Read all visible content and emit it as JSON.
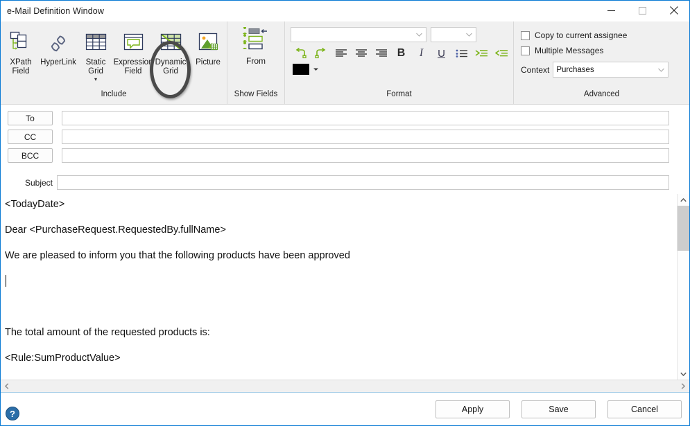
{
  "window": {
    "title": "e-Mail Definition Window",
    "controls": {
      "minimize": "minimize-button",
      "maximize": "maximize-button",
      "close": "close-button"
    }
  },
  "ribbon": {
    "groups": [
      {
        "label": "Include",
        "items": [
          {
            "caption": "XPath\nField",
            "icon": "xpath-field-icon",
            "has_caret": false
          },
          {
            "caption": "HyperLink",
            "icon": "hyperlink-icon",
            "has_caret": false
          },
          {
            "caption": "Static\nGrid",
            "icon": "static-grid-icon",
            "has_caret": true
          },
          {
            "caption": "Expression\nField",
            "icon": "expression-field-icon",
            "has_caret": false
          },
          {
            "caption": "Dynamic\nGrid",
            "icon": "dynamic-grid-icon",
            "has_caret": false
          },
          {
            "caption": "Picture",
            "icon": "picture-icon",
            "has_caret": false
          }
        ]
      },
      {
        "label": "Show Fields",
        "items": [
          {
            "caption": "From",
            "icon": "from-fields-icon",
            "has_caret": false
          }
        ]
      },
      {
        "label": "Format"
      },
      {
        "label": "Advanced"
      }
    ],
    "format": {
      "font_family": {
        "value": "",
        "placeholder": ""
      },
      "font_size": {
        "value": "",
        "placeholder": ""
      },
      "buttons": [
        {
          "name": "undo-button",
          "icon": "undo-icon",
          "label": "Undo"
        },
        {
          "name": "redo-button",
          "icon": "redo-icon",
          "label": "Redo"
        },
        {
          "name": "align-left-button",
          "icon": "align-left-icon",
          "label": "Align Left"
        },
        {
          "name": "align-center-button",
          "icon": "align-center-icon",
          "label": "Align Center"
        },
        {
          "name": "align-right-button",
          "icon": "align-right-icon",
          "label": "Align Right"
        },
        {
          "name": "bold-button",
          "icon": "bold-icon",
          "label": "B"
        },
        {
          "name": "italic-button",
          "icon": "italic-icon",
          "label": "I"
        },
        {
          "name": "underline-button",
          "icon": "underline-icon",
          "label": "U"
        },
        {
          "name": "bullet-list-button",
          "icon": "bullet-list-icon",
          "label": "Bullets"
        },
        {
          "name": "indent-increase-button",
          "icon": "indent-increase-icon",
          "label": "Increase Indent"
        },
        {
          "name": "indent-decrease-button",
          "icon": "indent-decrease-icon",
          "label": "Decrease Indent"
        }
      ],
      "text_color": "#000000"
    },
    "advanced": {
      "copy_to_assignee": {
        "label": "Copy to current assignee",
        "checked": false
      },
      "multiple_messages": {
        "label": "Multiple Messages",
        "checked": false
      },
      "context": {
        "label": "Context",
        "value": "Purchases"
      }
    }
  },
  "address": {
    "to": {
      "label": "To",
      "value": ""
    },
    "cc": {
      "label": "CC",
      "value": ""
    },
    "bcc": {
      "label": "BCC",
      "value": ""
    },
    "subject": {
      "label": "Subject",
      "value": ""
    }
  },
  "body": {
    "lines": [
      "<TodayDate>",
      "Dear <PurchaseRequest.RequestedBy.fullName>",
      "We are pleased to inform you that the following products have been approved",
      "The total amount of the requested products is:",
      "<Rule:SumProductValue>"
    ]
  },
  "footer": {
    "help": "help-icon",
    "apply": "Apply",
    "save": "Save",
    "cancel": "Cancel"
  },
  "colors": {
    "accent": "#0a7ad4",
    "ribbon_bg": "#f0f0f0",
    "icon_green": "#7ab317",
    "icon_navy": "#2e3a5c",
    "annotation": "#4a4a4a"
  }
}
